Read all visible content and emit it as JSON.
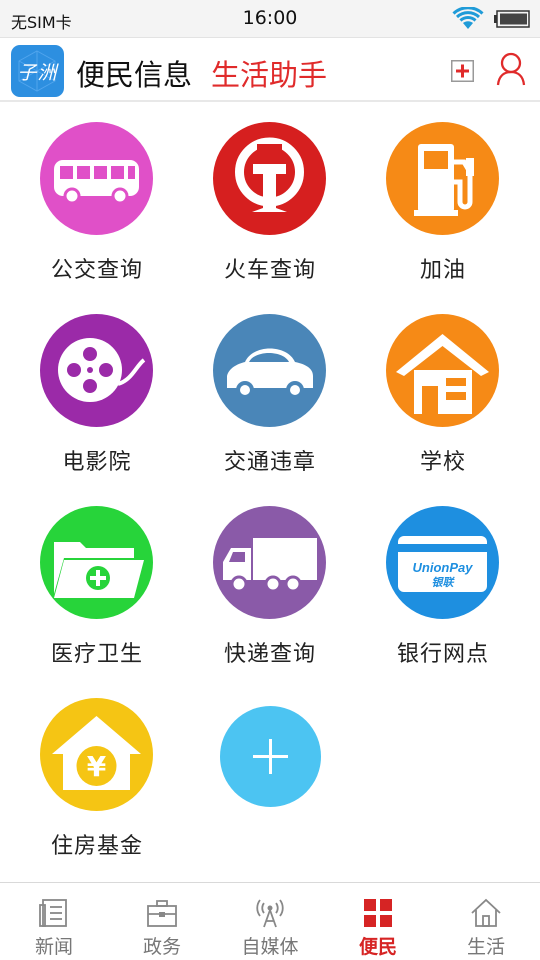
{
  "status_bar": {
    "carrier": "无SIM卡",
    "time": "16:00",
    "wifi_icon": "wifi-icon",
    "battery_icon": "battery-icon"
  },
  "header": {
    "logo_text": "子洲",
    "title": "便民信息",
    "subtitle": "生活助手",
    "subtitle_color": "#e02b2b",
    "add_icon": "add-icon",
    "user_icon": "user-icon"
  },
  "tiles": [
    {
      "label": "公交查询",
      "icon": "bus-icon",
      "color": "#e050c8"
    },
    {
      "label": "火车查询",
      "icon": "railway-icon",
      "color": "#d61f1f"
    },
    {
      "label": "加油",
      "icon": "fuel-pump-icon",
      "color": "#f68a16"
    },
    {
      "label": "电影院",
      "icon": "film-reel-icon",
      "color": "#9b2aa8"
    },
    {
      "label": "交通违章",
      "icon": "car-icon",
      "color": "#4a86b8"
    },
    {
      "label": "学校",
      "icon": "school-house-icon",
      "color": "#f68a16"
    },
    {
      "label": "医疗卫生",
      "icon": "medical-folder-icon",
      "color": "#27d43a"
    },
    {
      "label": "快递查询",
      "icon": "delivery-truck-icon",
      "color": "#8a5aa8"
    },
    {
      "label": "银行网点",
      "icon": "bank-card-icon",
      "color": "#1e8fe0"
    },
    {
      "label": "住房基金",
      "icon": "housing-fund-icon",
      "color": "#f5c514"
    },
    {
      "label": "",
      "icon": "add-plus-icon",
      "color": "#4cc4f2"
    }
  ],
  "bank_card": {
    "brand": "UnionPay",
    "brand_cn": "银联"
  },
  "housing_symbol": "¥",
  "bottom_nav": [
    {
      "label": "新闻",
      "icon": "news-icon",
      "active": false
    },
    {
      "label": "政务",
      "icon": "briefcase-icon",
      "active": false
    },
    {
      "label": "自媒体",
      "icon": "broadcast-icon",
      "active": false
    },
    {
      "label": "便民",
      "icon": "grid-icon",
      "active": true
    },
    {
      "label": "生活",
      "icon": "home-icon",
      "active": false
    }
  ],
  "colors": {
    "accent_red": "#d62424",
    "inactive_gray": "#777777"
  }
}
